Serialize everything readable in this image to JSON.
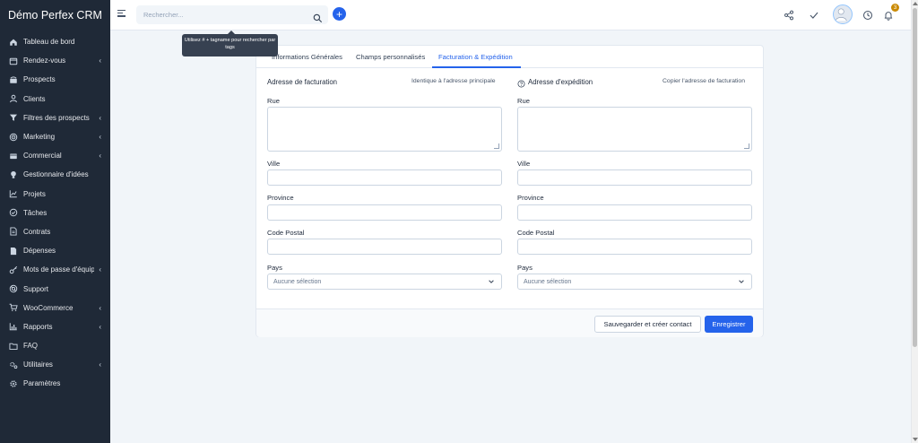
{
  "app": {
    "brand": "Démo Perfex CRM"
  },
  "sidebar": {
    "items": [
      {
        "label": "Tableau de bord",
        "icon": "home-icon",
        "has_submenu": false
      },
      {
        "label": "Rendez-vous",
        "icon": "calendar-icon",
        "has_submenu": true
      },
      {
        "label": "Prospects",
        "icon": "tty-icon",
        "has_submenu": false
      },
      {
        "label": "Clients",
        "icon": "user-icon",
        "has_submenu": false
      },
      {
        "label": "Filtres des prospects",
        "icon": "filter-icon",
        "has_submenu": true
      },
      {
        "label": "Marketing",
        "icon": "target-icon",
        "has_submenu": true
      },
      {
        "label": "Commercial",
        "icon": "invoice-icon",
        "has_submenu": true
      },
      {
        "label": "Gestionnaire d'idées",
        "icon": "lightbulb-icon",
        "has_submenu": false
      },
      {
        "label": "Projets",
        "icon": "chart-icon",
        "has_submenu": false
      },
      {
        "label": "Tâches",
        "icon": "check-circle-icon",
        "has_submenu": false
      },
      {
        "label": "Contrats",
        "icon": "contract-icon",
        "has_submenu": false
      },
      {
        "label": "Dépenses",
        "icon": "receipt-icon",
        "has_submenu": false
      },
      {
        "label": "Mots de passe d'équipe",
        "icon": "key-icon",
        "has_submenu": true
      },
      {
        "label": "Support",
        "icon": "lifebuoy-icon",
        "has_submenu": false
      },
      {
        "label": "WooCommerce",
        "icon": "cart-icon",
        "has_submenu": true
      },
      {
        "label": "Rapports",
        "icon": "bar-chart-icon",
        "has_submenu": true
      },
      {
        "label": "FAQ",
        "icon": "folder-icon",
        "has_submenu": false
      },
      {
        "label": "Utilitaires",
        "icon": "cogs-icon",
        "has_submenu": true
      },
      {
        "label": "Paramètres",
        "icon": "gear-icon",
        "has_submenu": false
      }
    ],
    "submenu_indicator": "‹"
  },
  "topbar": {
    "search_placeholder": "Rechercher...",
    "add_label": "+",
    "notification_count": "3"
  },
  "tooltip": {
    "text": "Utilisez # + tagname pour rechercher par tags"
  },
  "tabs": [
    {
      "label": "Informations Générales",
      "active": false
    },
    {
      "label": "Champs personnalisés",
      "active": false
    },
    {
      "label": "Facturation & Expédition",
      "active": true
    }
  ],
  "billing": {
    "title": "Adresse de facturation",
    "action": "Identique à l'adresse principale"
  },
  "shipping": {
    "title": "Adresse d'expédition",
    "action": "Copier l'adresse de facturation"
  },
  "fields": {
    "street": "Rue",
    "city": "Ville",
    "state": "Province",
    "zip": "Code Postal",
    "country": "Pays",
    "country_value": "Aucune sélection"
  },
  "buttons": {
    "save_and_create_contact": "Sauvegarder et créer contact",
    "save": "Enregistrer"
  },
  "colors": {
    "sidebar_bg": "#1f2937",
    "accent": "#2563eb",
    "page_bg": "#f1f5f9",
    "badge": "#ca8a04"
  }
}
